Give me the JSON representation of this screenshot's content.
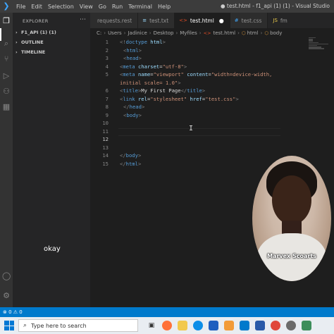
{
  "window": {
    "title": "● test.html - f1_api (1) (1) - Visual Studio"
  },
  "menu": [
    "File",
    "Edit",
    "Selection",
    "View",
    "Go",
    "Run",
    "Terminal",
    "Help"
  ],
  "activity_bar": {
    "icons": [
      "explorer-icon",
      "search-icon",
      "source-control-icon",
      "run-debug-icon",
      "remote-icon",
      "extensions-icon",
      "account-icon",
      "settings-gear-icon"
    ]
  },
  "sidebar": {
    "title": "EXPLORER",
    "more": "⋯",
    "sections": [
      {
        "label": "F1_API (1) (1)",
        "arrow": "›"
      },
      {
        "label": "OUTLINE",
        "arrow": "›"
      },
      {
        "label": "TIMELINE",
        "arrow": "›"
      }
    ]
  },
  "tabs": [
    {
      "label": "requests.rest",
      "icon": "request-icon",
      "glyph": ""
    },
    {
      "label": "test.txt",
      "icon": "text-file-icon",
      "glyph": "≡"
    },
    {
      "label": "test.html",
      "icon": "html-file-icon",
      "glyph": "<>",
      "active": true,
      "modified": "●"
    },
    {
      "label": "test.css",
      "icon": "css-file-icon",
      "glyph": "#"
    },
    {
      "label": "fm",
      "icon": "python-file-icon",
      "glyph": "JS"
    }
  ],
  "breadcrumb": [
    "C:",
    "Users",
    "Jadinice",
    "Desktop",
    "Myfiles",
    "test.html",
    "html",
    "body"
  ],
  "editor": {
    "lines": [
      {
        "n": "1",
        "indent": 0,
        "parts": [
          [
            "punc",
            "<!"
          ],
          [
            "tag",
            "doctype"
          ],
          [
            "text",
            " "
          ],
          [
            "attr",
            "html"
          ],
          [
            "punc",
            ">"
          ]
        ]
      },
      {
        "n": "2",
        "indent": 1,
        "parts": [
          [
            "punc",
            "<"
          ],
          [
            "tag",
            "html"
          ],
          [
            "punc",
            ">"
          ]
        ]
      },
      {
        "n": "3",
        "indent": 1,
        "parts": [
          [
            "punc",
            "<"
          ],
          [
            "tag",
            "head"
          ],
          [
            "punc",
            ">"
          ]
        ]
      },
      {
        "n": "4",
        "indent": 0,
        "parts": [
          [
            "punc",
            "<"
          ],
          [
            "tag",
            "meta"
          ],
          [
            "text",
            " "
          ],
          [
            "attr",
            "charset"
          ],
          [
            "text",
            "="
          ],
          [
            "str",
            "\"utf-8\""
          ],
          [
            "punc",
            ">"
          ]
        ]
      },
      {
        "n": "5",
        "indent": 0,
        "parts": [
          [
            "punc",
            "<"
          ],
          [
            "tag",
            "meta"
          ],
          [
            "text",
            " "
          ],
          [
            "attr",
            "name"
          ],
          [
            "text",
            "="
          ],
          [
            "str",
            "\"viewport\""
          ],
          [
            "text",
            " "
          ],
          [
            "attr",
            "content"
          ],
          [
            "text",
            "="
          ],
          [
            "str",
            "\"width=device-width,"
          ]
        ]
      },
      {
        "n": "",
        "indent": 0,
        "parts": [
          [
            "str",
            "initial scale= 1.0\""
          ],
          [
            "punc",
            ">"
          ]
        ]
      },
      {
        "n": "6",
        "indent": 0,
        "parts": [
          [
            "punc",
            "<"
          ],
          [
            "tag",
            "title"
          ],
          [
            "punc",
            ">"
          ],
          [
            "text",
            "My First Page"
          ],
          [
            "punc",
            "</"
          ],
          [
            "tag",
            "title"
          ],
          [
            "punc",
            ">"
          ]
        ]
      },
      {
        "n": "7",
        "indent": 0,
        "parts": [
          [
            "punc",
            "<"
          ],
          [
            "tag",
            "link"
          ],
          [
            "text",
            " "
          ],
          [
            "attr",
            "rel"
          ],
          [
            "text",
            "="
          ],
          [
            "str",
            "\"stylesheet\""
          ],
          [
            "text",
            " "
          ],
          [
            "attr",
            "href"
          ],
          [
            "text",
            "="
          ],
          [
            "str",
            "\"test.css\""
          ],
          [
            "punc",
            ">"
          ]
        ]
      },
      {
        "n": "8",
        "indent": 1,
        "parts": [
          [
            "punc",
            "</"
          ],
          [
            "tag",
            "head"
          ],
          [
            "punc",
            ">"
          ]
        ]
      },
      {
        "n": "9",
        "indent": 1,
        "parts": [
          [
            "punc",
            "<"
          ],
          [
            "tag",
            "body"
          ],
          [
            "punc",
            ">"
          ]
        ]
      },
      {
        "n": "10",
        "indent": 0,
        "parts": []
      },
      {
        "n": "11",
        "indent": 0,
        "parts": []
      },
      {
        "n": "12",
        "indent": 0,
        "parts": [],
        "current": true
      },
      {
        "n": "13",
        "indent": 0,
        "parts": []
      },
      {
        "n": "14",
        "indent": 0,
        "parts": [
          [
            "punc",
            "</"
          ],
          [
            "tag",
            "body"
          ],
          [
            "punc",
            ">"
          ]
        ]
      },
      {
        "n": "15",
        "indent": 0,
        "parts": [
          [
            "punc",
            "</"
          ],
          [
            "tag",
            "html"
          ],
          [
            "punc",
            ">"
          ]
        ]
      }
    ]
  },
  "overlay": {
    "webcam_label": "Marvex Scoarts",
    "caption": "okay"
  },
  "statusbar": {
    "problems": "⊗ 0 ⚠ 0"
  },
  "taskbar": {
    "search_placeholder": "Type here to search",
    "apps": [
      "task-view-icon",
      "firefox-icon",
      "file-explorer-icon",
      "edge-icon",
      "app-icon",
      "sublime-icon",
      "vscode-icon",
      "powershell-icon",
      "chrome-icon",
      "settings-icon",
      "app-icon-2"
    ]
  },
  "colors": {
    "accent": "#007acc",
    "keyword_tag": "#569cd6",
    "attribute": "#9cdcfe",
    "string": "#ce9178"
  }
}
